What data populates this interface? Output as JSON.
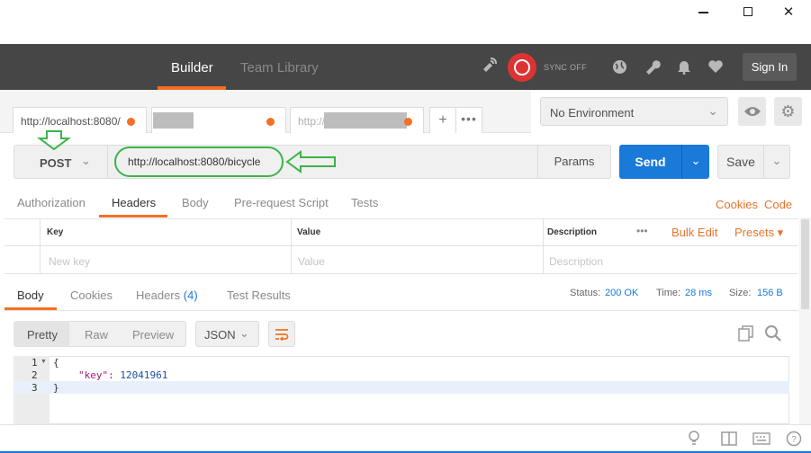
{
  "window": {
    "minimize": "—",
    "maximize": "□",
    "close": "✕"
  },
  "header": {
    "nav": [
      "Builder",
      "Team Library"
    ],
    "sync_label": "SYNC OFF",
    "sign_in": "Sign In",
    "icons": [
      "satellite-icon",
      "sync-icon",
      "globe-icon",
      "wrench-icon",
      "bell-icon",
      "heart-icon"
    ]
  },
  "tabs": [
    {
      "label": "http://localhost:8080/",
      "unsaved": true
    },
    {
      "label": "",
      "unsaved": true,
      "redacted": true
    },
    {
      "label": "http://",
      "unsaved": true,
      "redacted": true
    }
  ],
  "tab_actions": {
    "add": "+",
    "more": "•••"
  },
  "environment": {
    "selected": "No Environment"
  },
  "request": {
    "method": "POST",
    "url": "http://localhost:8080/bicycle",
    "params": "Params",
    "send": "Send",
    "save": "Save"
  },
  "request_tabs": [
    "Authorization",
    "Headers",
    "Body",
    "Pre-request Script",
    "Tests"
  ],
  "request_links": {
    "cookies": "Cookies",
    "code": "Code"
  },
  "headers_table": {
    "columns": {
      "key": "Key",
      "value": "Value",
      "description": "Description"
    },
    "actions": {
      "more": "•••",
      "bulk_edit": "Bulk Edit",
      "presets": "Presets ▾"
    },
    "placeholders": {
      "key": "New key",
      "value": "Value",
      "description": "Description"
    }
  },
  "response": {
    "tabs": {
      "body": "Body",
      "cookies": "Cookies",
      "headers": "Headers",
      "headers_count": "(4)",
      "tests": "Test Results"
    },
    "status_label": "Status:",
    "status": "200 OK",
    "time_label": "Time:",
    "time": "28 ms",
    "size_label": "Size:",
    "size": "156 B",
    "formats": [
      "Pretty",
      "Raw",
      "Preview"
    ],
    "language": "JSON",
    "code_lines": [
      "{",
      "\"key\": 12041961",
      "}"
    ],
    "line_numbers": [
      "1",
      "2",
      "3"
    ]
  },
  "colors": {
    "accent": "#f47023",
    "send": "#1a7ad9",
    "annotation": "#3bb44a",
    "header_bg": "#464646"
  }
}
